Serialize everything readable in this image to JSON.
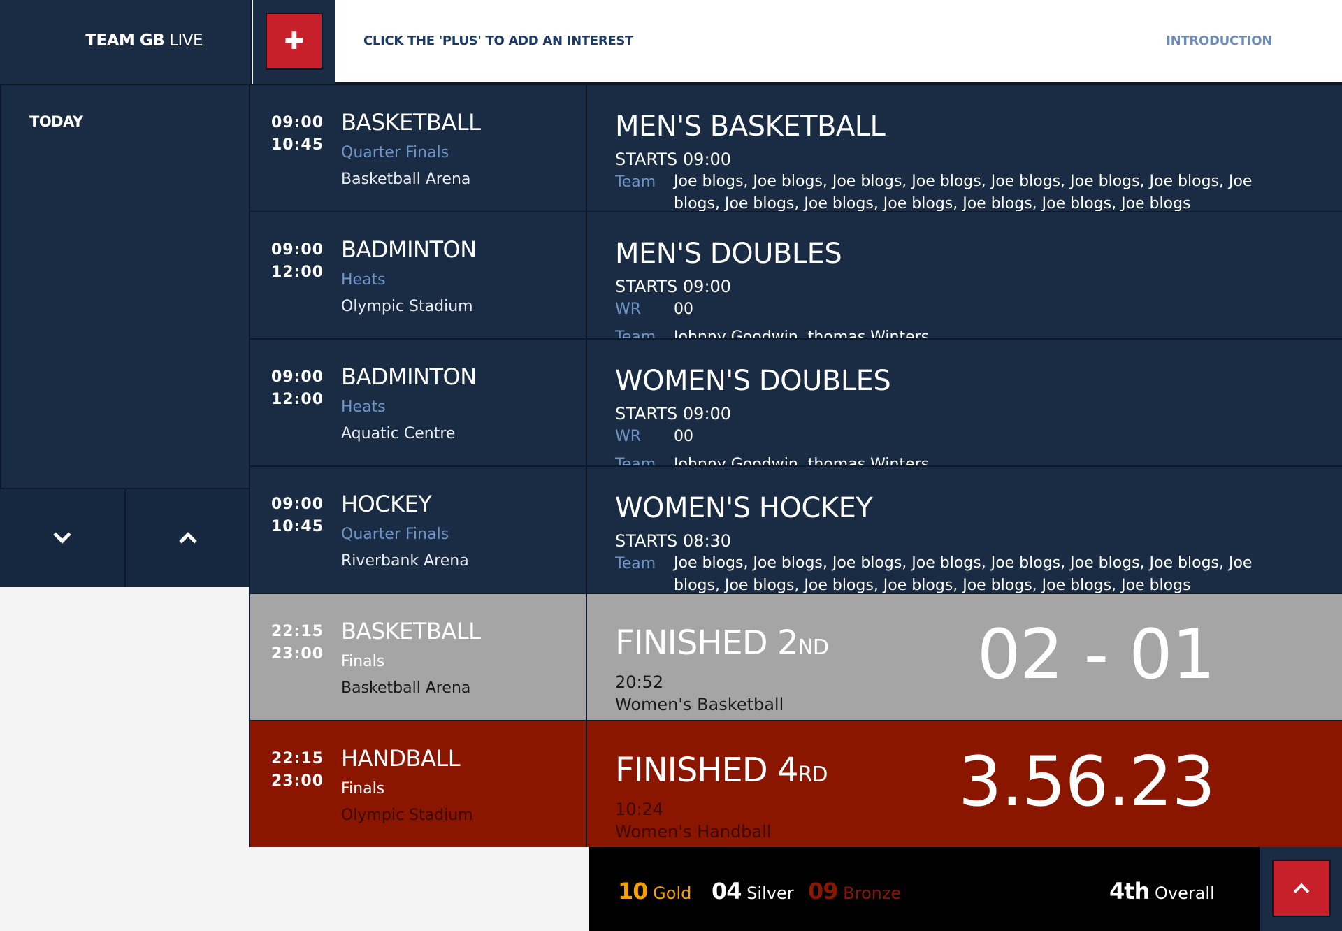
{
  "header": {
    "brand_bold": "TEAM GB",
    "brand_light": "LIVE",
    "plus_icon": "plus-icon",
    "hint": "CLICK THE 'PLUS' TO ADD AN INTEREST",
    "intro_link": "INTRODUCTION"
  },
  "sidebar": {
    "today_label": "TODAY",
    "down_icon": "chevron-down-icon",
    "up_icon": "chevron-up-icon"
  },
  "events": [
    {
      "start": "09:00",
      "end": "10:45",
      "sport": "BASKETBALL",
      "round": "Quarter Finals",
      "venue": "Basketball Arena",
      "title": "MEN'S BASKETBALL",
      "starts": "STARTS 09:00",
      "team_label": "Team",
      "team": "Joe blogs, Joe blogs, Joe blogs, Joe blogs, Joe blogs, Joe blogs, Joe blogs, Joe blogs, Joe blogs, Joe blogs, Joe blogs, Joe blogs, Joe blogs, Joe blogs"
    },
    {
      "start": "09:00",
      "end": "12:00",
      "sport": "BADMINTON",
      "round": "Heats",
      "venue": "Olympic Stadium",
      "title": "MEN'S DOUBLES",
      "starts": "STARTS 09:00",
      "wr_label": "WR",
      "wr_value": "00",
      "team_label": "Team",
      "team": "Johnny Goodwin, thomas Winters"
    },
    {
      "start": "09:00",
      "end": "12:00",
      "sport": "BADMINTON",
      "round": "Heats",
      "venue": "Aquatic Centre",
      "title": "WOMEN'S DOUBLES",
      "starts": "STARTS 09:00",
      "wr_label": "WR",
      "wr_value": "00",
      "team_label": "Team",
      "team": "Johnny Goodwin, thomas Winters"
    },
    {
      "start": "09:00",
      "end": "10:45",
      "sport": "HOCKEY",
      "round": "Quarter Finals",
      "venue": "Riverbank Arena",
      "title": "WOMEN'S HOCKEY",
      "starts": "STARTS 08:30",
      "team_label": "Team",
      "team": "Joe blogs, Joe blogs, Joe blogs, Joe blogs, Joe blogs, Joe blogs, Joe blogs, Joe blogs, Joe blogs, Joe blogs, Joe blogs, Joe blogs, Joe blogs, Joe blogs"
    },
    {
      "start": "22:15",
      "end": "23:00",
      "sport": "BASKETBALL",
      "round": "Finals",
      "venue": "Basketball Arena",
      "fin_text": "FINISHED 2",
      "fin_ord": "ND",
      "fin_time": "20:52",
      "fin_name": "Women's Basketball",
      "score": "02 - 01"
    },
    {
      "start": "22:15",
      "end": "23:00",
      "sport": "HANDBALL",
      "round": "Finals",
      "venue": "Olympic Stadium",
      "fin_text": "FINISHED 4",
      "fin_ord": "RD",
      "fin_time": "10:24",
      "fin_name": "Women's Handball",
      "score": "3.56.23"
    }
  ],
  "medals": {
    "gold_count": "10",
    "gold_label": "Gold",
    "silver_count": "04",
    "silver_label": "Silver",
    "bronze_count": "09",
    "bronze_label": "Bronze",
    "overall_rank": "4th",
    "overall_label": "Overall",
    "top_icon": "chevron-up-icon"
  },
  "colors": {
    "navy": "#1a2b44",
    "accent_red": "#c8202a",
    "finished_grey": "#a5a5a5",
    "finished_red": "#8a1600",
    "gold": "#f5a000",
    "link_blue": "#6d95c7"
  }
}
